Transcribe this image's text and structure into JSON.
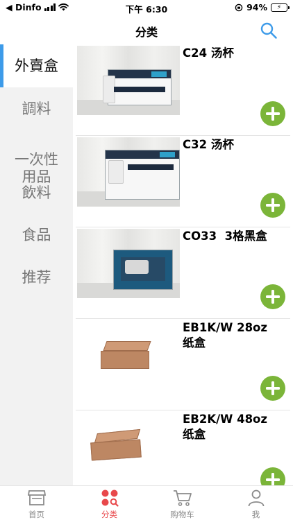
{
  "status_bar": {
    "back_label": "◀ Dinfo",
    "time": "下午 6:30",
    "battery_percent": "94%",
    "battery_level": 0.94
  },
  "nav": {
    "title": "分类",
    "search_icon": "search-icon"
  },
  "sidebar": {
    "items": [
      {
        "label": "外賣盒",
        "active": true
      },
      {
        "label": "調料",
        "active": false
      },
      {
        "label": "一次性\n用品",
        "active": false
      },
      {
        "label": "飲料",
        "active": false
      },
      {
        "label": "食品",
        "active": false
      },
      {
        "label": "推荐",
        "active": false
      }
    ]
  },
  "products": [
    {
      "name": "C24 汤杯",
      "image": "box-white-c24"
    },
    {
      "name": "C32 汤杯",
      "image": "box-white-c32"
    },
    {
      "name": "CO33  3格黑盒",
      "image": "box-blue-co33"
    },
    {
      "name": "EB1K/W 28oz\n纸盒",
      "image": "kraft-box"
    },
    {
      "name": "EB2K/W 48oz\n纸盒",
      "image": "kraft-box"
    }
  ],
  "add_icon": "plus-circle-icon",
  "tab_bar": {
    "items": [
      {
        "label": "首页",
        "icon": "store-icon",
        "active": false
      },
      {
        "label": "分类",
        "icon": "category-icon",
        "active": true
      },
      {
        "label": "购物车",
        "icon": "cart-icon",
        "active": false
      },
      {
        "label": "我",
        "icon": "profile-icon",
        "active": false
      }
    ]
  },
  "colors": {
    "accent_blue": "#3d9be9",
    "add_green": "#7bb539",
    "tab_active": "#e8484b",
    "tab_inactive": "#8a8a8a",
    "sidebar_bg": "#f2f2f2"
  }
}
